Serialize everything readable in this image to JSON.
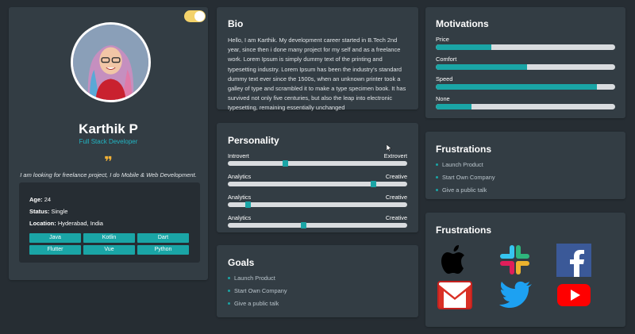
{
  "profile": {
    "name": "Karthik P",
    "role": "Full Stack Developer",
    "quote_mark": "❞",
    "tagline": "I am looking for freelance project, I do Mobile & Web Development.",
    "age_label": "Age:",
    "age": "24",
    "status_label": "Status:",
    "status": "Single",
    "location_label": "Location:",
    "location": "Hyderabad, India",
    "skills": [
      "Java",
      "Kotlin",
      "Dart",
      "Flutter",
      "Vue",
      "Python"
    ],
    "theme_toggle_on": true
  },
  "bio": {
    "title": "Bio",
    "text": "Hello, I am Karthik. My development career started in B.Tech 2nd year, since then i done many project for my self and as a freelance work. Lorem Ipsum is simply dummy text of the printing and typesetting industry. Lorem Ipsum has been the industry's standard dummy text ever since the 1500s, when an unknown printer took a galley of type and scrambled it to make a type specimen book. It has survived not only five centuries, but also the leap into electronic typesetting, remaining essentially unchanged"
  },
  "personality": {
    "title": "Personality",
    "traits": [
      {
        "left": "Introvert",
        "right": "Extrovert",
        "value": 0.32
      },
      {
        "left": "Analytics",
        "right": "Creative",
        "value": 0.81
      },
      {
        "left": "Analytics",
        "right": "Creative",
        "value": 0.11
      },
      {
        "left": "Analytics",
        "right": "Creative",
        "value": 0.42
      }
    ]
  },
  "goals": {
    "title": "Goals",
    "items": [
      "Launch Product",
      "Start Own Company",
      "Give a public talk"
    ]
  },
  "motivations": {
    "title": "Motivations",
    "items": [
      {
        "label": "Price",
        "value": 0.31
      },
      {
        "label": "Comfort",
        "value": 0.51
      },
      {
        "label": "Speed",
        "value": 0.9
      },
      {
        "label": "None",
        "value": 0.2
      }
    ]
  },
  "frustrations": {
    "title": "Frustrations",
    "items": [
      "Launch Product",
      "Start Own Company",
      "Give a public talk"
    ]
  },
  "brands": {
    "title": "Frustrations",
    "icons": [
      "apple-icon",
      "slack-icon",
      "facebook-icon",
      "gmail-icon",
      "twitter-icon",
      "youtube-icon"
    ]
  },
  "colors": {
    "accent": "#1aa5a6",
    "background": "#262d33",
    "card": "#333d44",
    "quote": "#f3b236"
  }
}
